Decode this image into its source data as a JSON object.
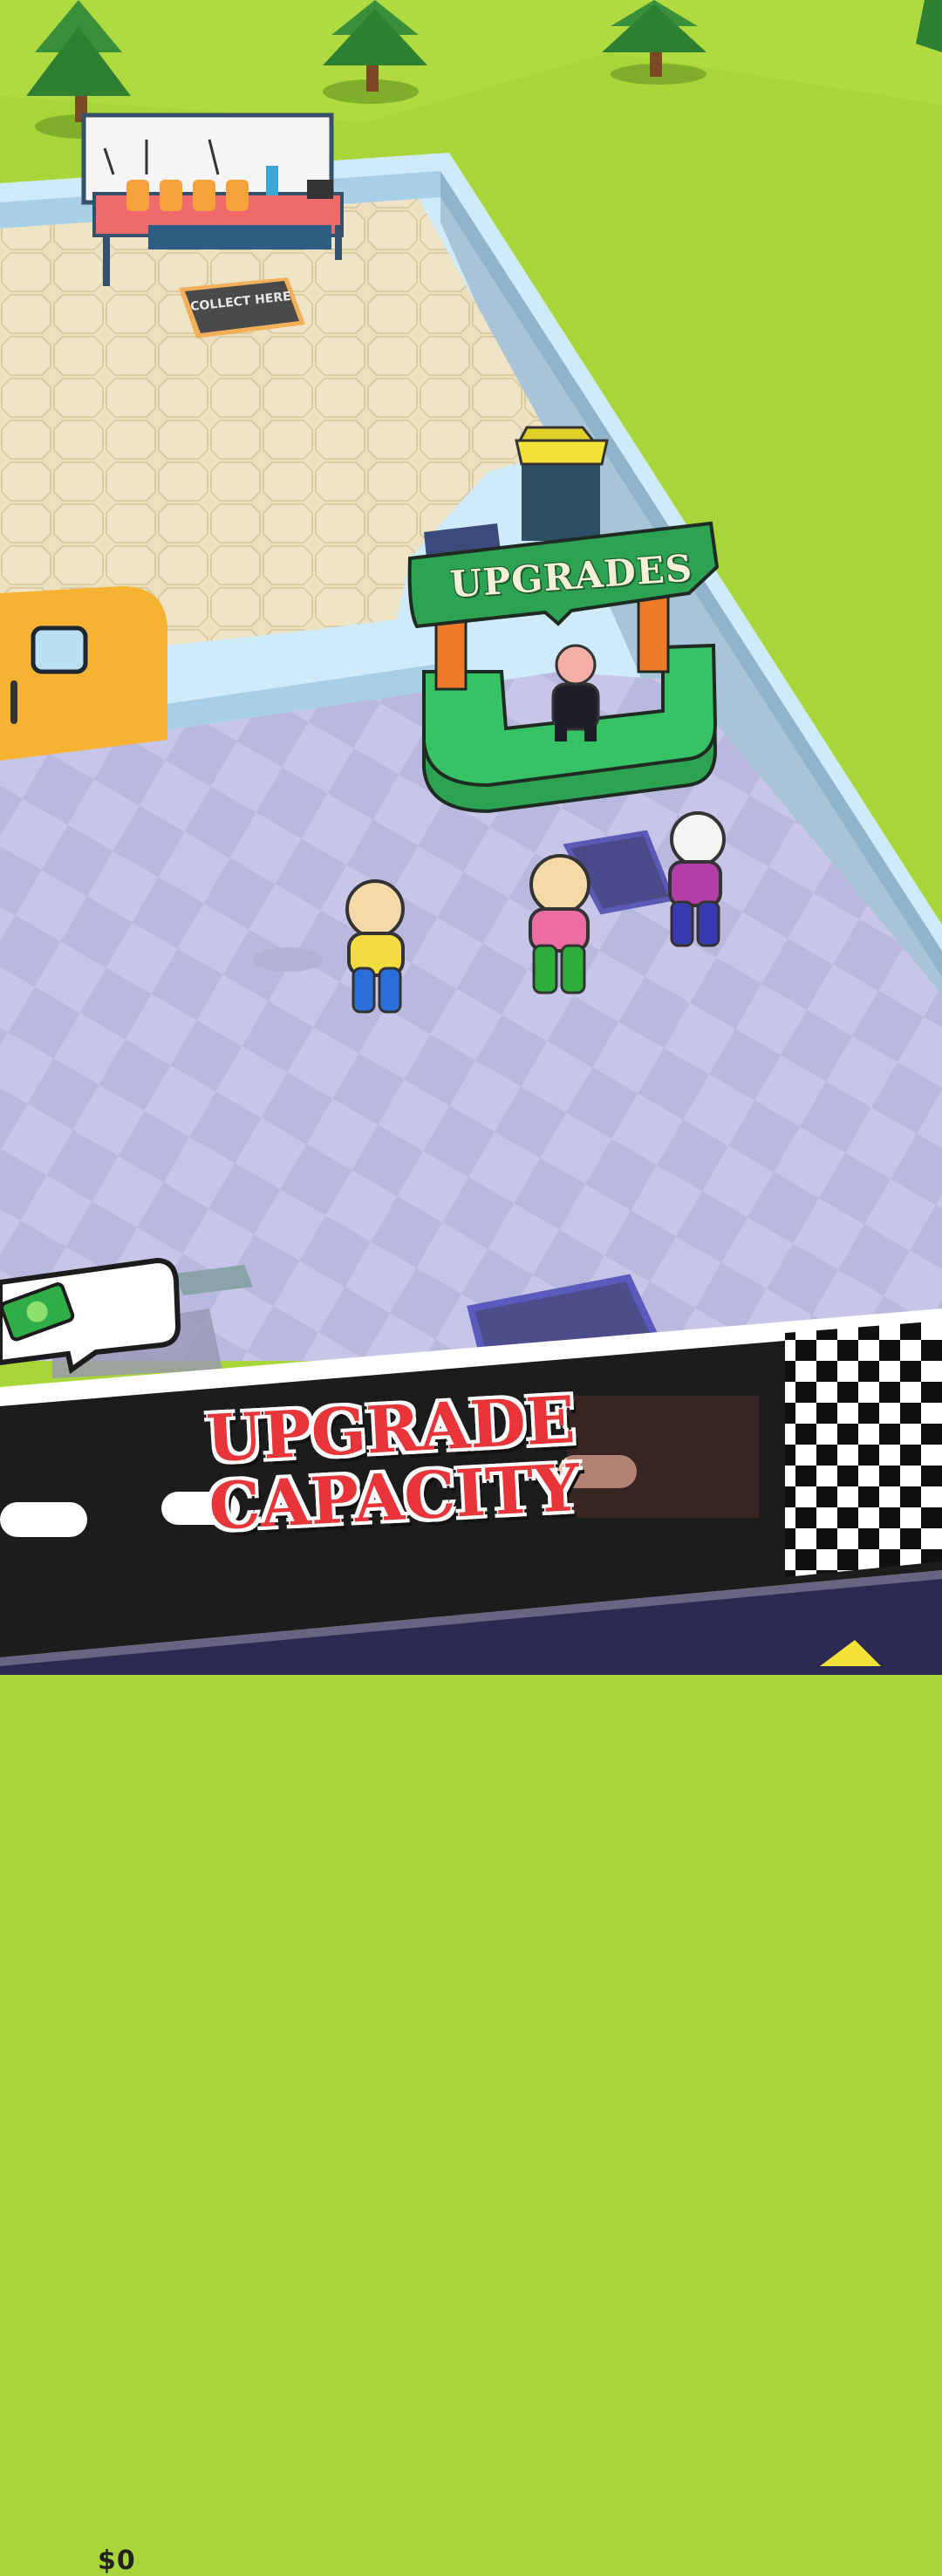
{
  "game": {
    "money": "$0",
    "upgrades_sign": "UPGRADES",
    "collect_zone": "COLLECT HERE",
    "banner": {
      "line1": "UPGRADE",
      "line2": "CAPACITY"
    }
  },
  "colors": {
    "grass": "#a8d63a",
    "tile_floor": "#ece0bf",
    "purple_floor": "#c5c4e6",
    "wall": "#bfe0f5",
    "upgrades_booth": "#2fb35a",
    "banner_red": "#e8353a",
    "road": "#1c1c1c"
  },
  "icons": [
    "cash-icon",
    "money-bubble",
    "trash-bin",
    "tool-workbench",
    "finish-checkered-flag"
  ]
}
